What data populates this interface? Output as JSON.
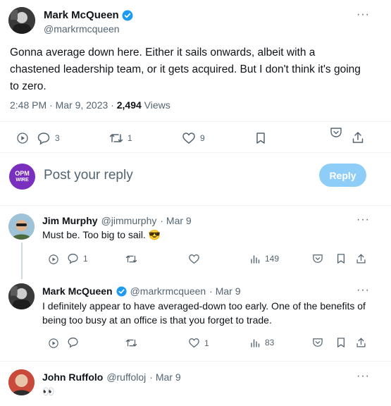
{
  "main_tweet": {
    "name": "Mark McQueen",
    "handle": "@markrmcqueen",
    "text_lines": [
      "Gonna average down here. Either it sails onwards, albeit with a",
      "chastened leadership team, or it gets acquired. But I don't think it's going",
      "to zero."
    ],
    "time": "2:48 PM · Mar 9, 2023 · ",
    "views_count": "2,494",
    "views_label": " Views",
    "replies": "3",
    "retweets": "1",
    "likes": "9"
  },
  "reply_box": {
    "avatar_text_top": "OPM",
    "avatar_text_bottom": "WIRE",
    "placeholder": "Post your reply",
    "reply_button": "Reply"
  },
  "replies": [
    {
      "name": "Jim Murphy",
      "handle": "@jimmurphy",
      "date": "· Mar 9",
      "text": "Must be. Too big to sail. 😎",
      "replies": "1",
      "retweets": "",
      "likes": "",
      "views": "149"
    },
    {
      "name": "Mark McQueen",
      "handle": "@markrmcqueen",
      "date": "· Mar 9",
      "text_lines": [
        "I definitely appear to have averaged-down too early. One of the benefits of",
        "being too busy at an office is that you forget to trade."
      ],
      "replies": "",
      "retweets": "",
      "likes": "1",
      "views": "83"
    },
    {
      "name": "John Ruffolo",
      "handle": "@ruffoloj",
      "date": "· Mar 9",
      "text": "👀"
    }
  ],
  "more_glyph": "···",
  "colors": {
    "verified": "#1d9bf0",
    "reply_button": "#8ecdf8",
    "opm_avatar": "#7b2fbe"
  }
}
